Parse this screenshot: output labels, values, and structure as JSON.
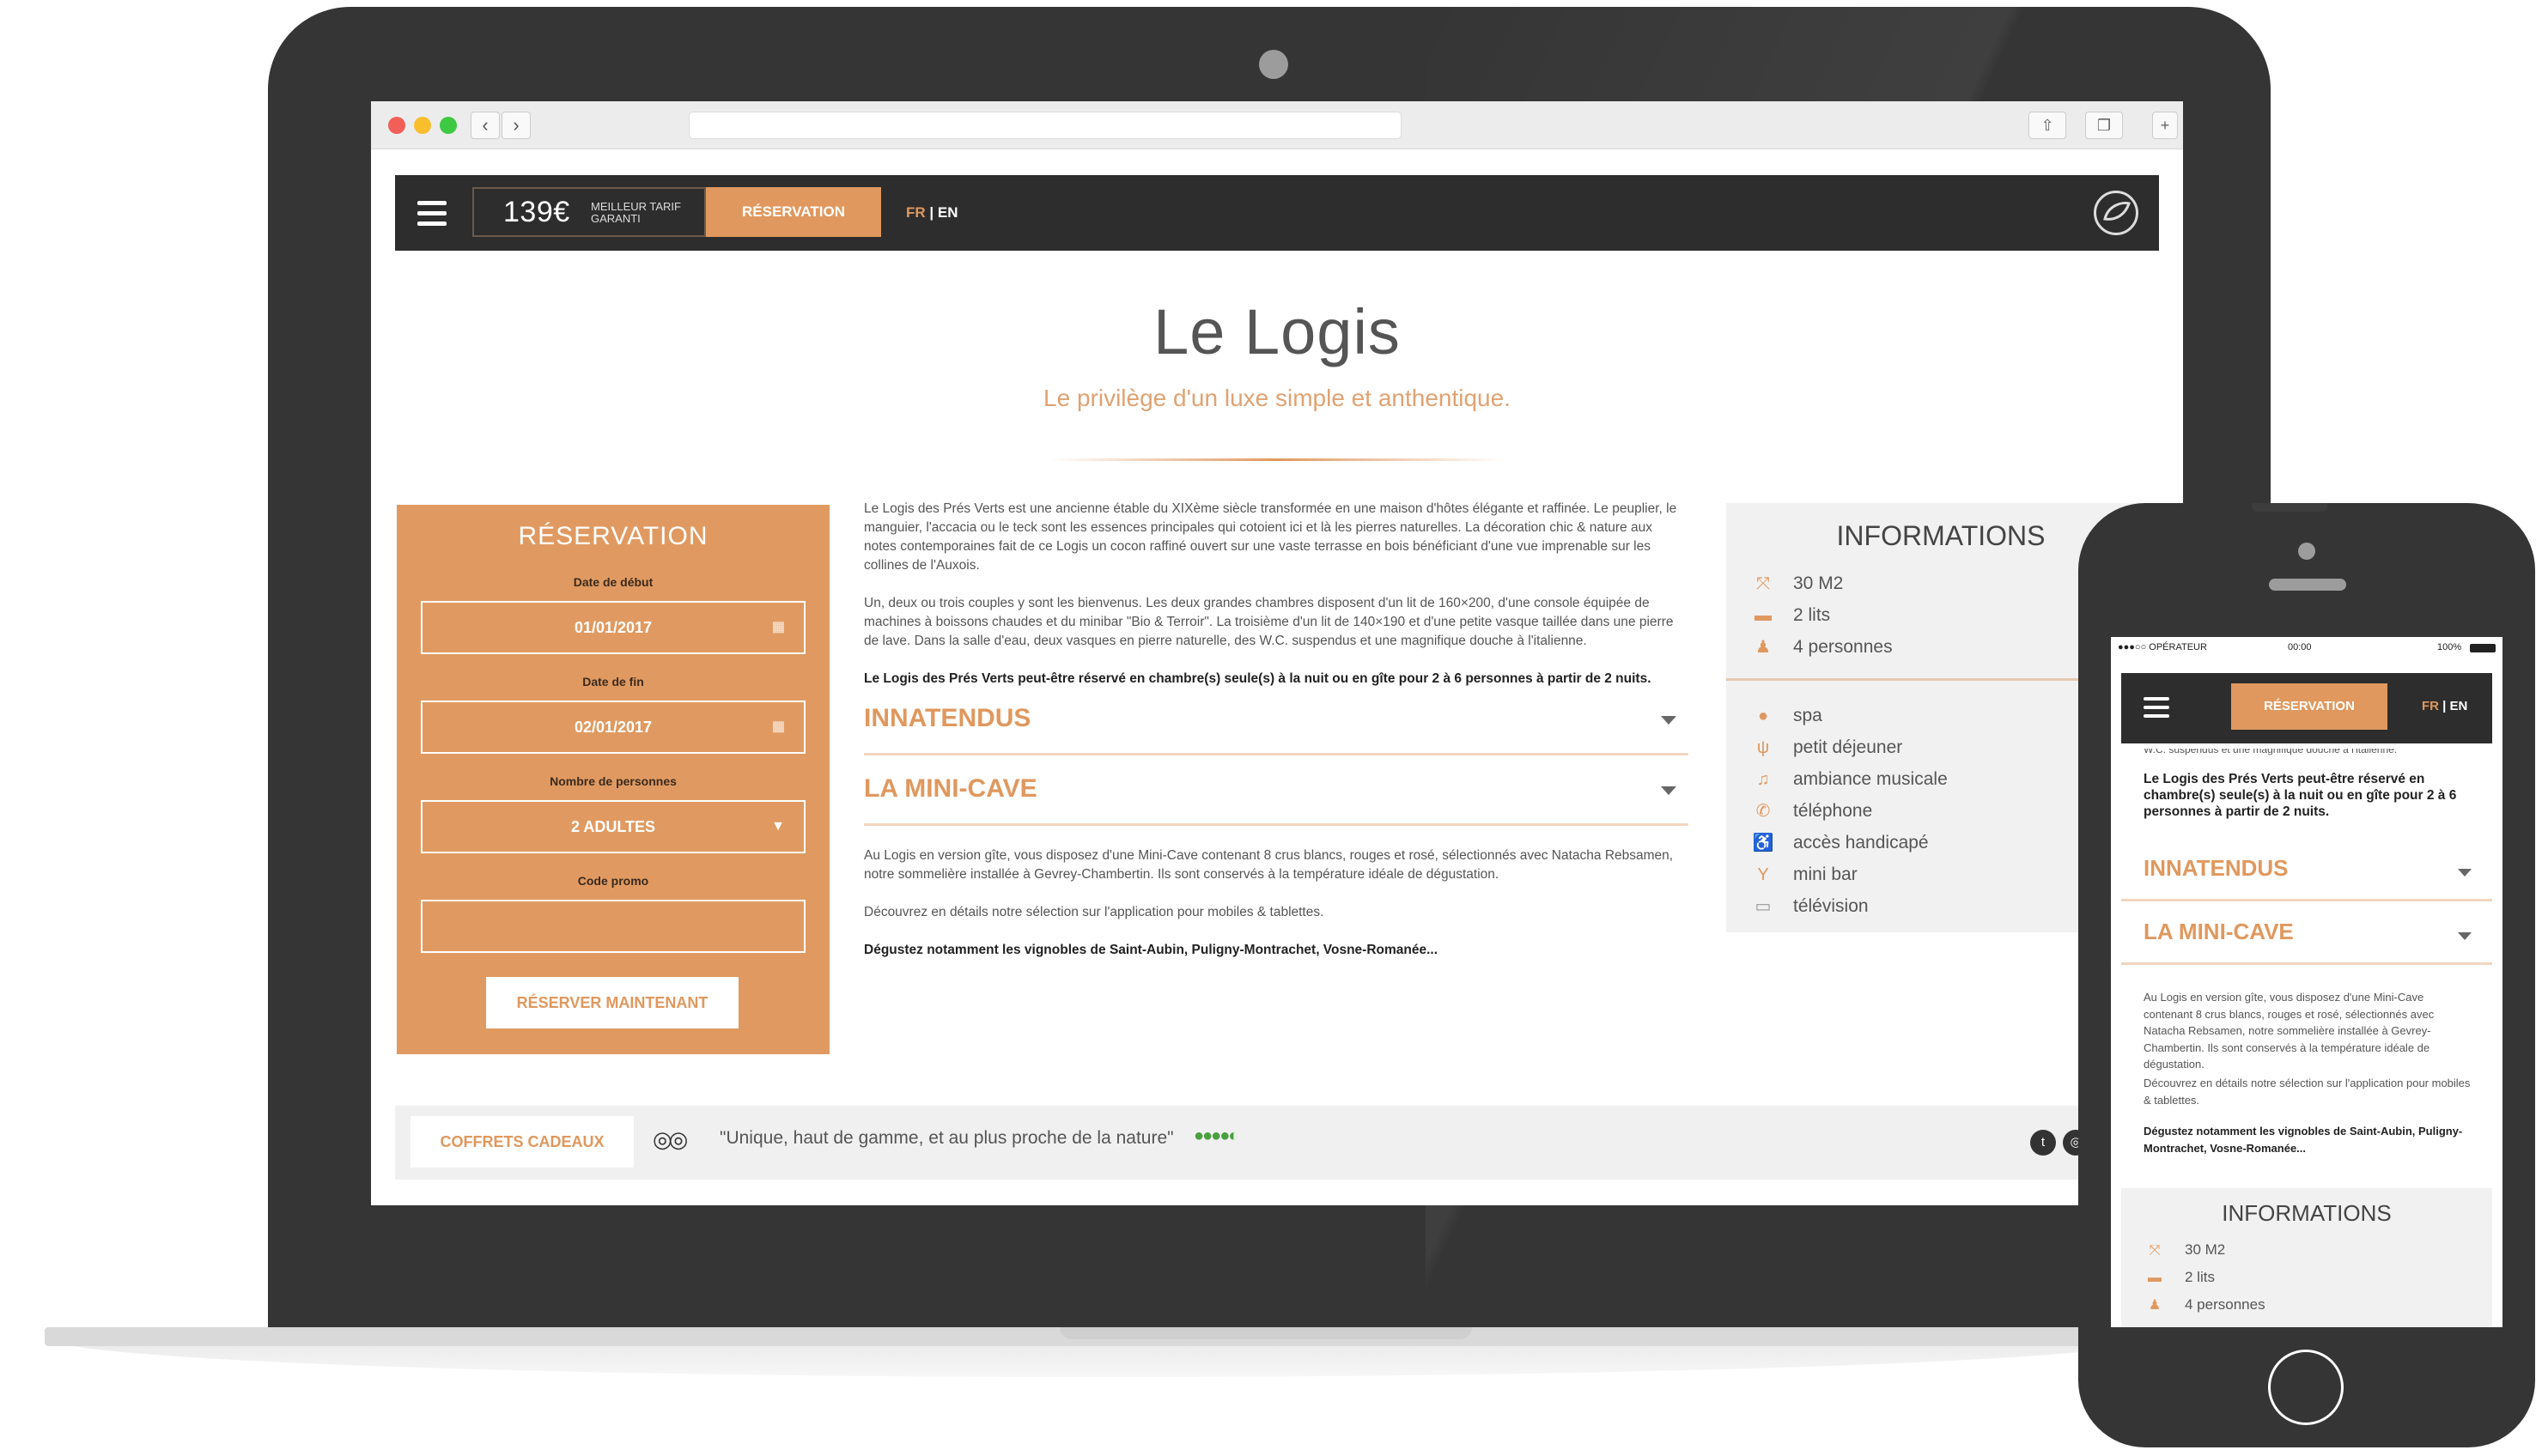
{
  "header": {
    "price": "139€",
    "price_note": "MEILLEUR TARIF GARANTI",
    "reservation_label": "RÉSERVATION",
    "lang_fr": "FR",
    "lang_sep": "|",
    "lang_en": "EN"
  },
  "page": {
    "title": "Le Logis",
    "subtitle": "Le privilège d'un luxe simple et anthentique."
  },
  "reservation": {
    "title": "RÉSERVATION",
    "start_label": "Date de début",
    "start_value": "01/01/2017",
    "end_label": "Date de fin",
    "end_value": "02/01/2017",
    "persons_label": "Nombre de personnes",
    "persons_value": "2 ADULTES",
    "promo_label": "Code promo",
    "promo_value": "",
    "submit_label": "RÉSERVER MAINTENANT"
  },
  "main": {
    "para1": "Le Logis des Prés Verts est une ancienne étable du XIXème siècle transformée en une maison d'hôtes élégante et raffinée. Le peuplier, le manguier, l'accacia ou le teck sont les essences principales qui cotoient ici et là les pierres naturelles. La décoration chic & nature aux notes contemporaines fait de ce Logis un cocon raffiné ouvert sur une vaste terrasse en bois bénéficiant d'une vue imprenable sur les collines de l'Auxois.",
    "para2": "Un, deux ou trois couples y sont les bienvenus. Les deux grandes chambres disposent d'un lit de 160×200, d'une console équipée de machines à boissons chaudes et du minibar \"Bio & Terroir\". La troisième d'un lit de 140×190 et d'une petite vasque taillée dans une pierre de lave. Dans la salle d'eau, deux vasques en pierre naturelle, des W.C. suspendus et une magnifique douche à l'italienne.",
    "para3": "Le Logis des Prés Verts peut-être réservé en chambre(s) seule(s) à la nuit ou en gîte pour  2 à 6 personnes à partir de 2 nuits.",
    "accordion1": "INNATENDUS",
    "accordion2": "LA MINI-CAVE",
    "cave_para1": "Au Logis en version gîte, vous disposez d'une Mini-Cave contenant 8 crus blancs, rouges et rosé, sélectionnés avec Natacha Rebsamen, notre sommelière installée à Gevrey-Chambertin. Ils sont conservés à la température idéale de dégustation.",
    "cave_para2": "Découvrez en détails notre sélection sur l'application pour mobiles & tablettes.",
    "cave_para3": "Dégustez notamment les vignobles de Saint-Aubin, Puligny-Montrachet, Vosne-Romanée..."
  },
  "info": {
    "title": "INFORMATIONS",
    "rows_top": [
      {
        "icon": "expand-icon",
        "label": "30 M2"
      },
      {
        "icon": "bed-icon",
        "label": "2 lits"
      },
      {
        "icon": "people-icon",
        "label": "4 personnes"
      }
    ],
    "rows_bottom": [
      {
        "icon": "drop-icon",
        "label": "spa"
      },
      {
        "icon": "cutlery-icon",
        "label": "petit déjeuner"
      },
      {
        "icon": "music-icon",
        "label": "ambiance musicale"
      },
      {
        "icon": "phone-icon",
        "label": "téléphone"
      },
      {
        "icon": "wheelchair-icon",
        "label": "accès handicapé"
      },
      {
        "icon": "cocktail-icon",
        "label": "mini bar"
      },
      {
        "icon": "tv-icon",
        "label": "télévision"
      }
    ]
  },
  "footer": {
    "gift_label": "COFFRETS CADEAUX",
    "quote": "\"Unique, haut de gamme, et au plus proche de la nature\"",
    "rating": "●●●●◐"
  },
  "phone": {
    "status_carrier": "●●●○○ OPÉRATEUR",
    "status_time": "00:00",
    "status_battery": "100%",
    "cut_text": "W.C. suspendus et une magnifique douche à l'italienne.",
    "cave_para1": "Au Logis en version gîte, vous disposez d'une Mini-Cave contenant 8 crus blancs, rouges et rosé, sélectionnés avec Natacha Rebsamen, notre sommelière installée à Gevrey-Chambertin. Ils sont conservés à la température idéale de dégustation.",
    "cave_para2": "Découvrez en détails notre sélection sur l'application pour mobiles & tablettes."
  },
  "colors": {
    "accent": "#e0985e",
    "dark": "#2d2d2d",
    "device": "#353535"
  }
}
